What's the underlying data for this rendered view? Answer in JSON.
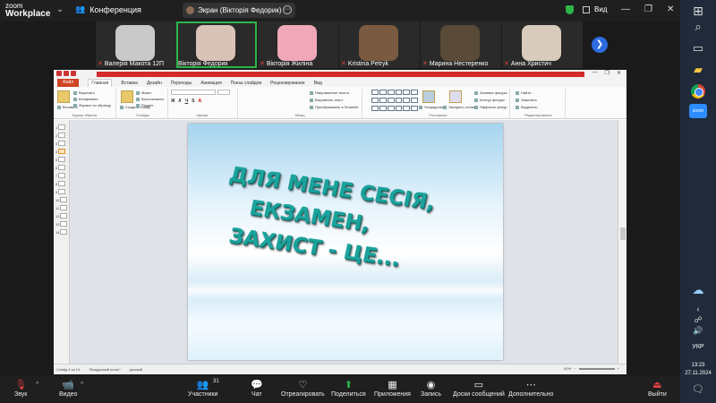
{
  "zoom": {
    "logo_top": "zoom",
    "logo_bottom": "Workplace",
    "meeting_title": "Конференция",
    "share_label": "Экран (Вікторія Федорик)",
    "view_label": "Вид",
    "participants": [
      {
        "name": "Валерія Макота 12П",
        "muted": true,
        "color": "#c9c9c9"
      },
      {
        "name": "Вікторія Федорик",
        "muted": false,
        "color": "#d9c2b8",
        "active": true
      },
      {
        "name": "Вікторія Жиліна",
        "muted": true,
        "color": "#f0a8b8"
      },
      {
        "name": "Kristina Petryk",
        "muted": true,
        "color": "#7a5a40"
      },
      {
        "name": "Марина Нестеренко",
        "muted": true,
        "color": "#5a4a38"
      },
      {
        "name": "Анна Христич",
        "muted": true,
        "color": "#d8cbbb"
      }
    ],
    "toolbar": {
      "audio": "Звук",
      "video": "Видео",
      "participants": "Участники",
      "participants_count": "31",
      "chat": "Чат",
      "react": "Отреагировать",
      "share": "Поделиться",
      "apps": "Приложения",
      "record": "Запись",
      "whiteboards": "Доски сообщений",
      "more": "Дополнительно",
      "leave": "Выйти"
    }
  },
  "powerpoint": {
    "tabs": [
      "Файл",
      "Главная",
      "Вставка",
      "Дизайн",
      "Переходы",
      "Анимация",
      "Показ слайдов",
      "Рецензирование",
      "Вид"
    ],
    "groups": [
      "Буфер обмена",
      "Слайды",
      "Шрифт",
      "Абзац",
      "Рисование",
      "Редактирование"
    ],
    "clipboard": {
      "paste": "Вставить",
      "cut": "Вырезать",
      "copy": "Копировать",
      "format": "Формат по образцу"
    },
    "slides": {
      "new": "Создать слайд",
      "layout": "Макет",
      "reset": "Восстановить",
      "section": "Раздел"
    },
    "paragraph": {
      "dir": "Направление текста",
      "align": "Выровнять текст",
      "smart": "Преобразовать в SmartArt"
    },
    "drawing": {
      "arrange": "Упорядочить",
      "styles": "Экспресс-стили",
      "fill": "Заливка фигуры",
      "outline": "Контур фигуры",
      "effects": "Эффекты фигур"
    },
    "editing": {
      "find": "Найти",
      "replace": "Заменить",
      "select": "Выделить"
    },
    "slide_numbers": [
      "1",
      "2",
      "3",
      "4",
      "5",
      "6",
      "7",
      "8",
      "9",
      "10",
      "11",
      "12",
      "13",
      "14"
    ],
    "selected_slide": "4",
    "slide_text": [
      "ДЛЯ МЕНЕ СЕСІЯ,",
      "ЕКЗАМЕН,",
      "ЗАХИСТ - ЦЕ..."
    ],
    "status": {
      "slide": "Слайд 4 из 14",
      "theme": "\"Воздушный поток\"",
      "lang": "русский",
      "zoom": "60%"
    }
  },
  "system": {
    "time": "13:23",
    "date": "27.11.2024",
    "lang": "УКР"
  }
}
